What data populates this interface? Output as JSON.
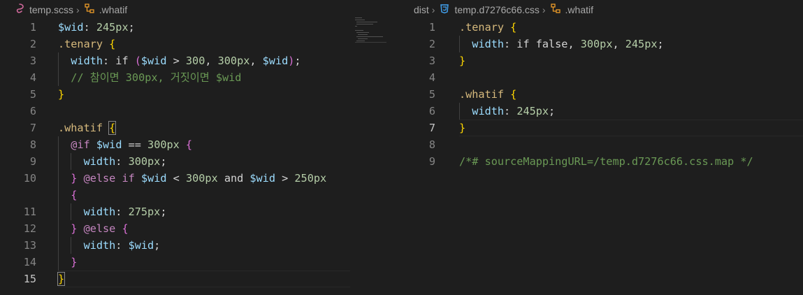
{
  "left": {
    "breadcrumb": {
      "file": "temp.scss",
      "symbol": ".whatif"
    },
    "lines": [
      {
        "n": "1",
        "tokens": [
          {
            "t": "$wid",
            "c": "var"
          },
          {
            "t": ": ",
            "c": "pl"
          },
          {
            "t": "245px",
            "c": "num"
          },
          {
            "t": ";",
            "c": "pl"
          }
        ]
      },
      {
        "n": "2",
        "tokens": [
          {
            "t": ".tenary",
            "c": "sel"
          },
          {
            "t": " ",
            "c": "pl"
          },
          {
            "t": "{",
            "c": "b1"
          }
        ]
      },
      {
        "n": "3",
        "tokens": [
          {
            "t": "  ",
            "c": "pl"
          },
          {
            "t": "width",
            "c": "prop"
          },
          {
            "t": ": if ",
            "c": "pl"
          },
          {
            "t": "(",
            "c": "b2"
          },
          {
            "t": "$wid",
            "c": "var"
          },
          {
            "t": " > ",
            "c": "pl"
          },
          {
            "t": "300",
            "c": "num"
          },
          {
            "t": ", ",
            "c": "pl"
          },
          {
            "t": "300px",
            "c": "num"
          },
          {
            "t": ", ",
            "c": "pl"
          },
          {
            "t": "$wid",
            "c": "var"
          },
          {
            "t": ")",
            "c": "b2"
          },
          {
            "t": ";",
            "c": "pl"
          }
        ]
      },
      {
        "n": "4",
        "tokens": [
          {
            "t": "  ",
            "c": "pl"
          },
          {
            "t": "// 참이면 300px, 거짓이면 $wid",
            "c": "com"
          }
        ]
      },
      {
        "n": "5",
        "tokens": [
          {
            "t": "}",
            "c": "b1"
          }
        ]
      },
      {
        "n": "6",
        "tokens": []
      },
      {
        "n": "7",
        "tokens": [
          {
            "t": ".whatif",
            "c": "sel"
          },
          {
            "t": " ",
            "c": "pl"
          },
          {
            "t": "{",
            "c": "b1 bm"
          }
        ]
      },
      {
        "n": "8",
        "tokens": [
          {
            "t": "  ",
            "c": "pl"
          },
          {
            "t": "@if",
            "c": "kw"
          },
          {
            "t": " ",
            "c": "pl"
          },
          {
            "t": "$wid",
            "c": "var"
          },
          {
            "t": " == ",
            "c": "pl"
          },
          {
            "t": "300px",
            "c": "num"
          },
          {
            "t": " ",
            "c": "pl"
          },
          {
            "t": "{",
            "c": "b2"
          }
        ]
      },
      {
        "n": "9",
        "tokens": [
          {
            "t": "    ",
            "c": "pl"
          },
          {
            "t": "width",
            "c": "prop"
          },
          {
            "t": ": ",
            "c": "pl"
          },
          {
            "t": "300px",
            "c": "num"
          },
          {
            "t": ";",
            "c": "pl"
          }
        ]
      },
      {
        "n": "10",
        "tokens": [
          {
            "t": "  ",
            "c": "pl"
          },
          {
            "t": "}",
            "c": "b2"
          },
          {
            "t": " ",
            "c": "pl"
          },
          {
            "t": "@else",
            "c": "kw"
          },
          {
            "t": " ",
            "c": "pl"
          },
          {
            "t": "if",
            "c": "kw"
          },
          {
            "t": " ",
            "c": "pl"
          },
          {
            "t": "$wid",
            "c": "var"
          },
          {
            "t": " < ",
            "c": "pl"
          },
          {
            "t": "300px",
            "c": "num"
          },
          {
            "t": " and ",
            "c": "pl"
          },
          {
            "t": "$wid",
            "c": "var"
          },
          {
            "t": " > ",
            "c": "pl"
          },
          {
            "t": "250px",
            "c": "num"
          }
        ]
      },
      {
        "n": "",
        "tokens": [
          {
            "t": "  ",
            "c": "pl"
          },
          {
            "t": "{",
            "c": "b2"
          }
        ]
      },
      {
        "n": "11",
        "tokens": [
          {
            "t": "    ",
            "c": "pl"
          },
          {
            "t": "width",
            "c": "prop"
          },
          {
            "t": ": ",
            "c": "pl"
          },
          {
            "t": "275px",
            "c": "num"
          },
          {
            "t": ";",
            "c": "pl"
          }
        ]
      },
      {
        "n": "12",
        "tokens": [
          {
            "t": "  ",
            "c": "pl"
          },
          {
            "t": "}",
            "c": "b2"
          },
          {
            "t": " ",
            "c": "pl"
          },
          {
            "t": "@else",
            "c": "kw"
          },
          {
            "t": " ",
            "c": "pl"
          },
          {
            "t": "{",
            "c": "b2"
          }
        ]
      },
      {
        "n": "13",
        "tokens": [
          {
            "t": "    ",
            "c": "pl"
          },
          {
            "t": "width",
            "c": "prop"
          },
          {
            "t": ": ",
            "c": "pl"
          },
          {
            "t": "$wid",
            "c": "var"
          },
          {
            "t": ";",
            "c": "pl"
          }
        ]
      },
      {
        "n": "14",
        "tokens": [
          {
            "t": "  ",
            "c": "pl"
          },
          {
            "t": "}",
            "c": "b2"
          }
        ]
      },
      {
        "n": "15",
        "tokens": [
          {
            "t": "}",
            "c": "b1 bm"
          }
        ],
        "active": true
      }
    ]
  },
  "right": {
    "breadcrumb": {
      "folder": "dist",
      "file": "temp.d7276c66.css",
      "symbol": ".whatif"
    },
    "lines": [
      {
        "n": "1",
        "tokens": [
          {
            "t": ".tenary",
            "c": "sel"
          },
          {
            "t": " ",
            "c": "pl"
          },
          {
            "t": "{",
            "c": "b1"
          }
        ]
      },
      {
        "n": "2",
        "tokens": [
          {
            "t": "  ",
            "c": "pl"
          },
          {
            "t": "width",
            "c": "prop"
          },
          {
            "t": ": if false, ",
            "c": "pl"
          },
          {
            "t": "300px",
            "c": "num"
          },
          {
            "t": ", ",
            "c": "pl"
          },
          {
            "t": "245px",
            "c": "num"
          },
          {
            "t": ";",
            "c": "pl"
          }
        ]
      },
      {
        "n": "3",
        "tokens": [
          {
            "t": "}",
            "c": "b1"
          }
        ]
      },
      {
        "n": "4",
        "tokens": []
      },
      {
        "n": "5",
        "tokens": [
          {
            "t": ".whatif",
            "c": "sel"
          },
          {
            "t": " ",
            "c": "pl"
          },
          {
            "t": "{",
            "c": "b1"
          }
        ]
      },
      {
        "n": "6",
        "tokens": [
          {
            "t": "  ",
            "c": "pl"
          },
          {
            "t": "width",
            "c": "prop"
          },
          {
            "t": ": ",
            "c": "pl"
          },
          {
            "t": "245px",
            "c": "num"
          },
          {
            "t": ";",
            "c": "pl"
          }
        ]
      },
      {
        "n": "7",
        "tokens": [
          {
            "t": "}",
            "c": "b1"
          }
        ],
        "active": true
      },
      {
        "n": "8",
        "tokens": []
      },
      {
        "n": "9",
        "tokens": [
          {
            "t": "/*# sourceMappingURL=/temp.d7276c66.css.map */",
            "c": "com"
          }
        ]
      }
    ]
  },
  "icons": {
    "scss_file": "sass-icon",
    "css_file": "css3-icon",
    "symbol": "symbol-structure-icon"
  },
  "colors": {
    "background": "#1e1e1e",
    "selector": "#d7ba7d",
    "property": "#9cdcfe",
    "number": "#b5cea8",
    "keyword": "#c586c0",
    "comment": "#6a9955",
    "bracket1": "#ffd700",
    "bracket2": "#da70d6"
  }
}
